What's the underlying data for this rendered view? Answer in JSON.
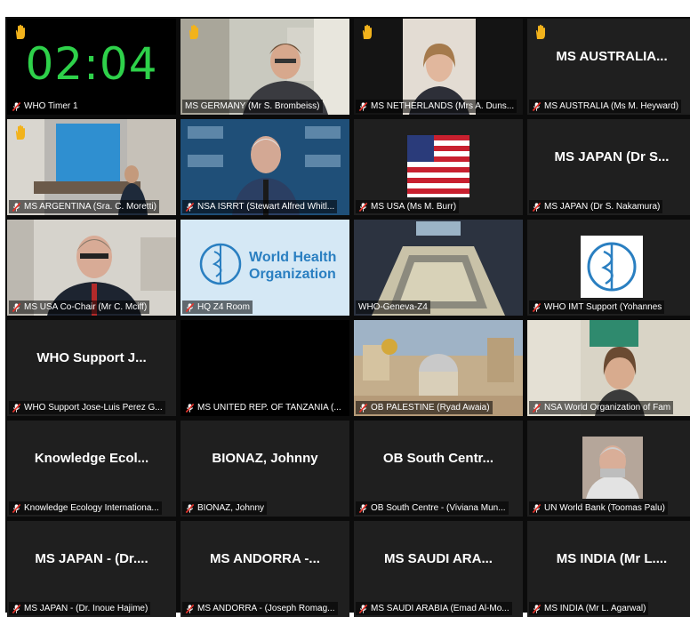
{
  "timer": {
    "value": "02:04"
  },
  "tiles": [
    {
      "label": "WHO Timer 1"
    },
    {
      "label": "MS GERMANY (Mr S. Brombeiss)"
    },
    {
      "label": "MS NETHERLANDS (Mrs A. Duns..."
    },
    {
      "label": "MS AUSTRALIA (Ms M. Heyward)",
      "name": "MS AUSTRALIA..."
    },
    {
      "label": "MS ARGENTINA (Sra. C. Moretti)"
    },
    {
      "label": "NSA ISRRT (Stewart Alfred Whitl..."
    },
    {
      "label": "MS USA (Ms M. Burr)"
    },
    {
      "label": "MS JAPAN (Dr S. Nakamura)",
      "name": "MS JAPAN (Dr S..."
    },
    {
      "label": "MS USA Co-Chair (Mr C. Mciff)"
    },
    {
      "label": "HQ Z4 Room",
      "logo_line1": "World Health",
      "logo_line2": "Organization"
    },
    {
      "label": "WHO-Geneva-Z4"
    },
    {
      "label": "WHO IMT Support (Yohannes"
    },
    {
      "label": "WHO Support Jose-Luis Perez G...",
      "name": "WHO Support J..."
    },
    {
      "label": "MS UNITED REP. OF TANZANIA (..."
    },
    {
      "label": "OB PALESTINE (Ryad Awaia)"
    },
    {
      "label": "NSA World Organization of Fam"
    },
    {
      "label": "Knowledge Ecology Internationa...",
      "name": "Knowledge Ecol..."
    },
    {
      "label": "BIONAZ, Johnny",
      "name": "BIONAZ, Johnny"
    },
    {
      "label": "OB South Centre - (Viviana Mun...",
      "name": "OB South Centr..."
    },
    {
      "label": "UN World Bank (Toomas Palu)"
    },
    {
      "label": "MS JAPAN - (Dr. Inoue Hajime)",
      "name": "MS JAPAN - (Dr...."
    },
    {
      "label": "MS ANDORRA - (Joseph Romag...",
      "name": "MS ANDORRA -..."
    },
    {
      "label": "MS SAUDI ARABIA (Emad Al-Mo...",
      "name": "MS SAUDI ARA..."
    },
    {
      "label": "MS INDIA (Mr L. Agarwal)",
      "name": "MS INDIA (Mr L...."
    }
  ],
  "colors": {
    "timer": "#2ed14a",
    "muted_mic": "#e8332b",
    "hand": "#f2b31c",
    "highlight": "#e6dc54"
  },
  "icons": {
    "mic": "muted-microphone-icon",
    "hand": "raised-hand-icon"
  }
}
